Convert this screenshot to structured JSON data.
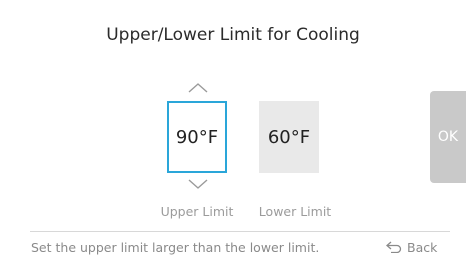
{
  "screen": {
    "title": "Upper/Lower Limit for Cooling"
  },
  "upper_limit": {
    "value": "90°F",
    "label": "Upper Limit",
    "selected": true
  },
  "lower_limit": {
    "value": "60°F",
    "label": "Lower Limit",
    "selected": false
  },
  "ok_button": {
    "label": "OK"
  },
  "footer": {
    "hint": "Set the upper limit larger than the lower limit.",
    "back_label": "Back"
  },
  "icons": {
    "increase": "chevron-up-icon",
    "decrease": "chevron-down-icon",
    "back": "back-arrow-icon"
  },
  "colors": {
    "accent": "#2aa6d9",
    "ok_disabled": "#c9c9c9",
    "inactive_box": "#e9e9e9"
  }
}
